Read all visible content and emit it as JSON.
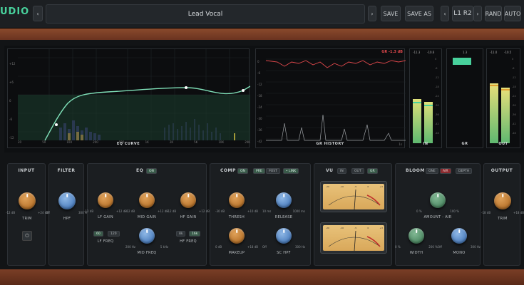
{
  "header": {
    "logo": "UDIO",
    "prev_arrow": "‹",
    "next_arrow": "›",
    "preset_name": "Lead Vocal",
    "save": "SAVE",
    "save_as": "SAVE AS",
    "ab_prev": "‹",
    "ab_next": "›",
    "ab_label": "L1 R2",
    "rand": "RAND",
    "auto": "AUTO"
  },
  "eq_display": {
    "label": "EQ CURVE",
    "y_ticks": [
      "+12",
      "+6",
      "0",
      "-6",
      "-12",
      "-18"
    ],
    "x_ticks": [
      "20",
      "50",
      "100",
      "200",
      "500",
      "1K",
      "2K",
      "5K",
      "10K",
      "20K"
    ]
  },
  "gr_display": {
    "label": "GR HISTORY",
    "gr_readout": "GR -1.3 dB",
    "y_ticks": [
      "0",
      "-6",
      "-12",
      "-18",
      "-24",
      "-30",
      "-36",
      "-42",
      "-48"
    ],
    "x_tick": "1s"
  },
  "meters": {
    "in_label": "IN",
    "in_peak": "-11.3",
    "in_peak_r": "-10.6",
    "gr_label": "GR",
    "gr_peak": "1.3",
    "out_label": "OUT",
    "out_peak": "-11.0",
    "out_peak_r": "-10.5",
    "scale": [
      "0",
      "-6",
      "-12",
      "-18",
      "-24",
      "-30",
      "-36",
      "-42",
      "-48",
      "-54"
    ]
  },
  "input": {
    "title": "INPUT",
    "trim_label": "TRIM",
    "min": "-12 dB",
    "max": "+24 dB",
    "power_icon": "⏻"
  },
  "filter": {
    "title": "FILTER",
    "hpf_label": "HPF",
    "min": "Off",
    "max": "300 Hz"
  },
  "eq": {
    "title": "EQ",
    "toggle": "ON",
    "lf_gain": "LF GAIN",
    "mid_gain": "MID GAIN",
    "hf_gain": "HF GAIN",
    "gain_min": "-12 dB",
    "gain_max": "+12 dB",
    "lf_freq": "LF FREQ",
    "hf_freq": "HF FREQ",
    "mid_freq": "MID FREQ",
    "lf_btn1": "60",
    "lf_btn2": "120",
    "hf_btn1": "8k",
    "hf_btn2": "16k",
    "mid_min": "200 Hz",
    "mid_max": "5 kHz"
  },
  "comp": {
    "title": "COMP",
    "toggle": "ON",
    "pre": "PRE",
    "post": "POST",
    "link": "• LINK",
    "thresh": "THRESH",
    "release": "RELEASE",
    "makeup": "MAKEUP",
    "sc_hpf": "SC HPF",
    "thresh_min": "-30 dB",
    "thresh_max": "+10 dB",
    "rel_min": "10 ms",
    "rel_max": "1000 ms",
    "mk_min": "0 dB",
    "mk_max": "+18 dB",
    "sc_min": "Off",
    "sc_max": "300 Hz"
  },
  "vu": {
    "title": "VU",
    "btn_in": "IN",
    "btn_out": "OUT",
    "btn_gr": "GR",
    "scale": [
      "-20",
      "-10",
      "-7",
      "-5",
      "-3",
      "-1",
      "0",
      "+1",
      "+2",
      "+3"
    ]
  },
  "bloom": {
    "title": "BLOOM",
    "btn1": "ONE",
    "btn2": "AIR",
    "btn3": "DEPTH",
    "amount": "AMOUNT - AIR",
    "amount_min": "0 %",
    "amount_max": "100 %",
    "width": "WIDTH",
    "width_min": "0 %",
    "width_max": "200 %",
    "mono": "MONO",
    "mono_min": "Off",
    "mono_max": "300 Hz"
  },
  "output": {
    "title": "OUTPUT",
    "trim_label": "TRIM",
    "min": "-18 dB",
    "max": "+18 dB"
  },
  "colors": {
    "accent_green": "#48d19c",
    "eq_curve": "#7fe0b8",
    "gr_red": "#e0484c",
    "knob_orange": "#c9853a",
    "knob_blue": "#5a8fd0",
    "knob_green": "#5a9a70"
  }
}
